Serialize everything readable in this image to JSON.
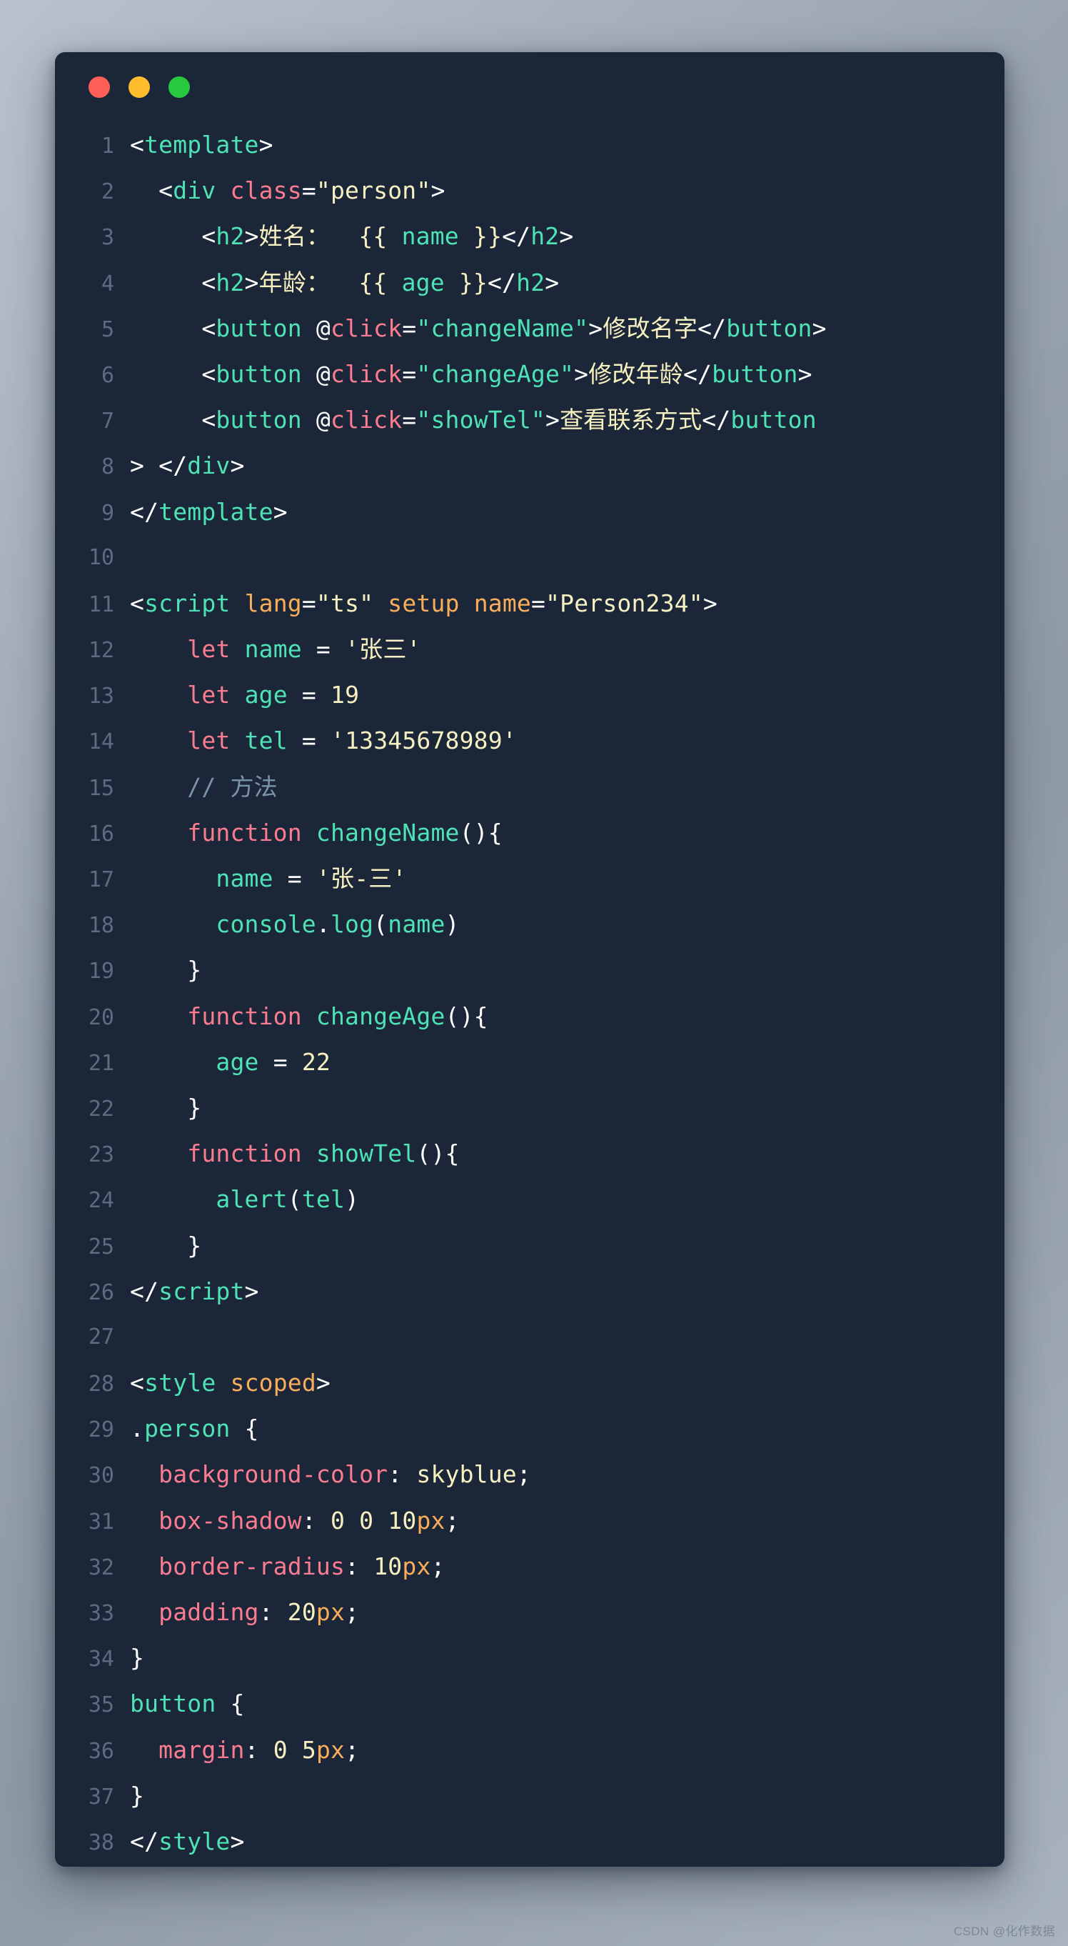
{
  "window": {
    "traffic_lights": [
      {
        "name": "close",
        "color": "#ff5f56"
      },
      {
        "name": "minimize",
        "color": "#ffbd2e"
      },
      {
        "name": "maximize",
        "color": "#27c93f"
      }
    ]
  },
  "editor": {
    "language": "vue",
    "theme_background": "#1b2738",
    "line_count": 38,
    "colors": {
      "punctuation": "#ffffff",
      "tag": "#4ee2b5",
      "attribute": "#fb7b91",
      "attribute_alt": "#f9ad5a",
      "string": "#f7f0c0",
      "keyword": "#fb7b91",
      "function": "#4ee2b5",
      "number": "#f7f0c0",
      "comment": "#7b93a8",
      "property": "#fb7b91",
      "unit": "#f9ad5a",
      "line_number": "#5d6b7f"
    },
    "lines": [
      {
        "n": "1",
        "tokens": [
          {
            "t": "<",
            "c": "punct"
          },
          {
            "t": "template",
            "c": "tag"
          },
          {
            "t": ">",
            "c": "punct"
          }
        ]
      },
      {
        "n": "2",
        "tokens": [
          {
            "t": "  <",
            "c": "punct"
          },
          {
            "t": "div",
            "c": "tag"
          },
          {
            "t": " ",
            "c": "plain"
          },
          {
            "t": "class",
            "c": "attr"
          },
          {
            "t": "=",
            "c": "punct"
          },
          {
            "t": "\"person\"",
            "c": "string"
          },
          {
            "t": ">",
            "c": "punct"
          }
        ]
      },
      {
        "n": "3",
        "tokens": [
          {
            "t": "     <",
            "c": "punct"
          },
          {
            "t": "h2",
            "c": "tag"
          },
          {
            "t": ">",
            "c": "punct"
          },
          {
            "t": "姓名：  {{ ",
            "c": "text"
          },
          {
            "t": "name",
            "c": "var"
          },
          {
            "t": " }}",
            "c": "text"
          },
          {
            "t": "</",
            "c": "punct"
          },
          {
            "t": "h2",
            "c": "tag"
          },
          {
            "t": ">",
            "c": "punct"
          }
        ]
      },
      {
        "n": "4",
        "tokens": [
          {
            "t": "     <",
            "c": "punct"
          },
          {
            "t": "h2",
            "c": "tag"
          },
          {
            "t": ">",
            "c": "punct"
          },
          {
            "t": "年龄：  {{ ",
            "c": "text"
          },
          {
            "t": "age",
            "c": "var"
          },
          {
            "t": " }}",
            "c": "text"
          },
          {
            "t": "</",
            "c": "punct"
          },
          {
            "t": "h2",
            "c": "tag"
          },
          {
            "t": ">",
            "c": "punct"
          }
        ]
      },
      {
        "n": "5",
        "tokens": [
          {
            "t": "     <",
            "c": "punct"
          },
          {
            "t": "button",
            "c": "tag"
          },
          {
            "t": " @",
            "c": "punct"
          },
          {
            "t": "click",
            "c": "attr"
          },
          {
            "t": "=",
            "c": "punct"
          },
          {
            "t": "\"changeName\"",
            "c": "tag"
          },
          {
            "t": ">",
            "c": "punct"
          },
          {
            "t": "修改名字",
            "c": "text"
          },
          {
            "t": "</",
            "c": "punct"
          },
          {
            "t": "button",
            "c": "tag"
          },
          {
            "t": ">",
            "c": "punct"
          }
        ]
      },
      {
        "n": "6",
        "tokens": [
          {
            "t": "     <",
            "c": "punct"
          },
          {
            "t": "button",
            "c": "tag"
          },
          {
            "t": " @",
            "c": "punct"
          },
          {
            "t": "click",
            "c": "attr"
          },
          {
            "t": "=",
            "c": "punct"
          },
          {
            "t": "\"changeAge\"",
            "c": "tag"
          },
          {
            "t": ">",
            "c": "punct"
          },
          {
            "t": "修改年龄",
            "c": "text"
          },
          {
            "t": "</",
            "c": "punct"
          },
          {
            "t": "button",
            "c": "tag"
          },
          {
            "t": ">",
            "c": "punct"
          }
        ]
      },
      {
        "n": "7",
        "tokens": [
          {
            "t": "     <",
            "c": "punct"
          },
          {
            "t": "button",
            "c": "tag"
          },
          {
            "t": " @",
            "c": "punct"
          },
          {
            "t": "click",
            "c": "attr"
          },
          {
            "t": "=",
            "c": "punct"
          },
          {
            "t": "\"showTel\"",
            "c": "tag"
          },
          {
            "t": ">",
            "c": "punct"
          },
          {
            "t": "查看联系方式",
            "c": "text"
          },
          {
            "t": "</",
            "c": "punct"
          },
          {
            "t": "button",
            "c": "tag"
          }
        ]
      },
      {
        "n": "8",
        "tokens": [
          {
            "t": "> </",
            "c": "punct"
          },
          {
            "t": "div",
            "c": "tag"
          },
          {
            "t": ">",
            "c": "punct"
          }
        ]
      },
      {
        "n": "9",
        "tokens": [
          {
            "t": "</",
            "c": "punct"
          },
          {
            "t": "template",
            "c": "tag"
          },
          {
            "t": ">",
            "c": "punct"
          }
        ]
      },
      {
        "n": "10",
        "tokens": []
      },
      {
        "n": "11",
        "tokens": [
          {
            "t": "<",
            "c": "punct"
          },
          {
            "t": "script",
            "c": "tag"
          },
          {
            "t": " ",
            "c": "plain"
          },
          {
            "t": "lang",
            "c": "attr2"
          },
          {
            "t": "=",
            "c": "punct"
          },
          {
            "t": "\"ts\"",
            "c": "string"
          },
          {
            "t": " ",
            "c": "plain"
          },
          {
            "t": "setup",
            "c": "attr2"
          },
          {
            "t": " ",
            "c": "plain"
          },
          {
            "t": "name",
            "c": "attr2"
          },
          {
            "t": "=",
            "c": "punct"
          },
          {
            "t": "\"Person234\"",
            "c": "string"
          },
          {
            "t": ">",
            "c": "punct"
          }
        ]
      },
      {
        "n": "12",
        "tokens": [
          {
            "t": "    ",
            "c": "plain"
          },
          {
            "t": "let",
            "c": "kw"
          },
          {
            "t": " ",
            "c": "plain"
          },
          {
            "t": "name",
            "c": "var"
          },
          {
            "t": " ",
            "c": "plain"
          },
          {
            "t": "=",
            "c": "punct"
          },
          {
            "t": " ",
            "c": "plain"
          },
          {
            "t": "'张三'",
            "c": "string"
          }
        ]
      },
      {
        "n": "13",
        "tokens": [
          {
            "t": "    ",
            "c": "plain"
          },
          {
            "t": "let",
            "c": "kw"
          },
          {
            "t": " ",
            "c": "plain"
          },
          {
            "t": "age",
            "c": "var"
          },
          {
            "t": " ",
            "c": "plain"
          },
          {
            "t": "=",
            "c": "punct"
          },
          {
            "t": " ",
            "c": "plain"
          },
          {
            "t": "19",
            "c": "num"
          }
        ]
      },
      {
        "n": "14",
        "tokens": [
          {
            "t": "    ",
            "c": "plain"
          },
          {
            "t": "let",
            "c": "kw"
          },
          {
            "t": " ",
            "c": "plain"
          },
          {
            "t": "tel",
            "c": "var"
          },
          {
            "t": " ",
            "c": "plain"
          },
          {
            "t": "=",
            "c": "punct"
          },
          {
            "t": " ",
            "c": "plain"
          },
          {
            "t": "'13345678989'",
            "c": "string"
          }
        ]
      },
      {
        "n": "15",
        "tokens": [
          {
            "t": "    ",
            "c": "plain"
          },
          {
            "t": "// 方法",
            "c": "comment"
          }
        ]
      },
      {
        "n": "16",
        "tokens": [
          {
            "t": "    ",
            "c": "plain"
          },
          {
            "t": "function",
            "c": "kw"
          },
          {
            "t": " ",
            "c": "plain"
          },
          {
            "t": "changeName",
            "c": "fn"
          },
          {
            "t": "(){",
            "c": "punct"
          }
        ]
      },
      {
        "n": "17",
        "tokens": [
          {
            "t": "      ",
            "c": "plain"
          },
          {
            "t": "name",
            "c": "var"
          },
          {
            "t": " ",
            "c": "plain"
          },
          {
            "t": "=",
            "c": "punct"
          },
          {
            "t": " ",
            "c": "plain"
          },
          {
            "t": "'张-三'",
            "c": "string"
          }
        ]
      },
      {
        "n": "18",
        "tokens": [
          {
            "t": "      ",
            "c": "plain"
          },
          {
            "t": "console",
            "c": "fn"
          },
          {
            "t": ".",
            "c": "punct"
          },
          {
            "t": "log",
            "c": "fn"
          },
          {
            "t": "(",
            "c": "punct"
          },
          {
            "t": "name",
            "c": "var"
          },
          {
            "t": ")",
            "c": "punct"
          }
        ]
      },
      {
        "n": "19",
        "tokens": [
          {
            "t": "    }",
            "c": "punct"
          }
        ]
      },
      {
        "n": "20",
        "tokens": [
          {
            "t": "    ",
            "c": "plain"
          },
          {
            "t": "function",
            "c": "kw"
          },
          {
            "t": " ",
            "c": "plain"
          },
          {
            "t": "changeAge",
            "c": "fn"
          },
          {
            "t": "(){",
            "c": "punct"
          }
        ]
      },
      {
        "n": "21",
        "tokens": [
          {
            "t": "      ",
            "c": "plain"
          },
          {
            "t": "age",
            "c": "var"
          },
          {
            "t": " ",
            "c": "plain"
          },
          {
            "t": "=",
            "c": "punct"
          },
          {
            "t": " ",
            "c": "plain"
          },
          {
            "t": "22",
            "c": "num"
          }
        ]
      },
      {
        "n": "22",
        "tokens": [
          {
            "t": "    }",
            "c": "punct"
          }
        ]
      },
      {
        "n": "23",
        "tokens": [
          {
            "t": "    ",
            "c": "plain"
          },
          {
            "t": "function",
            "c": "kw"
          },
          {
            "t": " ",
            "c": "plain"
          },
          {
            "t": "showTel",
            "c": "fn"
          },
          {
            "t": "(){",
            "c": "punct"
          }
        ]
      },
      {
        "n": "24",
        "tokens": [
          {
            "t": "      ",
            "c": "plain"
          },
          {
            "t": "alert",
            "c": "fn"
          },
          {
            "t": "(",
            "c": "punct"
          },
          {
            "t": "tel",
            "c": "var"
          },
          {
            "t": ")",
            "c": "punct"
          }
        ]
      },
      {
        "n": "25",
        "tokens": [
          {
            "t": "    }",
            "c": "punct"
          }
        ]
      },
      {
        "n": "26",
        "tokens": [
          {
            "t": "</",
            "c": "punct"
          },
          {
            "t": "script",
            "c": "tag"
          },
          {
            "t": ">",
            "c": "punct"
          }
        ]
      },
      {
        "n": "27",
        "tokens": []
      },
      {
        "n": "28",
        "tokens": [
          {
            "t": "<",
            "c": "punct"
          },
          {
            "t": "style",
            "c": "tag"
          },
          {
            "t": " ",
            "c": "plain"
          },
          {
            "t": "scoped",
            "c": "attr2"
          },
          {
            "t": ">",
            "c": "punct"
          }
        ]
      },
      {
        "n": "29",
        "tokens": [
          {
            "t": ".",
            "c": "punct"
          },
          {
            "t": "person",
            "c": "sel"
          },
          {
            "t": " {",
            "c": "punct"
          }
        ]
      },
      {
        "n": "30",
        "tokens": [
          {
            "t": "  ",
            "c": "plain"
          },
          {
            "t": "background-color",
            "c": "prop"
          },
          {
            "t": ":",
            "c": "punct"
          },
          {
            "t": " ",
            "c": "plain"
          },
          {
            "t": "skyblue",
            "c": "string"
          },
          {
            "t": ";",
            "c": "punct"
          }
        ]
      },
      {
        "n": "31",
        "tokens": [
          {
            "t": "  ",
            "c": "plain"
          },
          {
            "t": "box-shadow",
            "c": "prop"
          },
          {
            "t": ":",
            "c": "punct"
          },
          {
            "t": " ",
            "c": "plain"
          },
          {
            "t": "0",
            "c": "num"
          },
          {
            "t": " ",
            "c": "plain"
          },
          {
            "t": "0",
            "c": "num"
          },
          {
            "t": " ",
            "c": "plain"
          },
          {
            "t": "10",
            "c": "num"
          },
          {
            "t": "px",
            "c": "unit"
          },
          {
            "t": ";",
            "c": "punct"
          }
        ]
      },
      {
        "n": "32",
        "tokens": [
          {
            "t": "  ",
            "c": "plain"
          },
          {
            "t": "border-radius",
            "c": "prop"
          },
          {
            "t": ":",
            "c": "punct"
          },
          {
            "t": " ",
            "c": "plain"
          },
          {
            "t": "10",
            "c": "num"
          },
          {
            "t": "px",
            "c": "unit"
          },
          {
            "t": ";",
            "c": "punct"
          }
        ]
      },
      {
        "n": "33",
        "tokens": [
          {
            "t": "  ",
            "c": "plain"
          },
          {
            "t": "padding",
            "c": "prop"
          },
          {
            "t": ":",
            "c": "punct"
          },
          {
            "t": " ",
            "c": "plain"
          },
          {
            "t": "20",
            "c": "num"
          },
          {
            "t": "px",
            "c": "unit"
          },
          {
            "t": ";",
            "c": "punct"
          }
        ]
      },
      {
        "n": "34",
        "tokens": [
          {
            "t": "}",
            "c": "punct"
          }
        ]
      },
      {
        "n": "35",
        "tokens": [
          {
            "t": "button",
            "c": "sel"
          },
          {
            "t": " {",
            "c": "punct"
          }
        ]
      },
      {
        "n": "36",
        "tokens": [
          {
            "t": "  ",
            "c": "plain"
          },
          {
            "t": "margin",
            "c": "prop"
          },
          {
            "t": ":",
            "c": "punct"
          },
          {
            "t": " ",
            "c": "plain"
          },
          {
            "t": "0",
            "c": "num"
          },
          {
            "t": " ",
            "c": "plain"
          },
          {
            "t": "5",
            "c": "num"
          },
          {
            "t": "px",
            "c": "unit"
          },
          {
            "t": ";",
            "c": "punct"
          }
        ]
      },
      {
        "n": "37",
        "tokens": [
          {
            "t": "}",
            "c": "punct"
          }
        ]
      },
      {
        "n": "38",
        "tokens": [
          {
            "t": "</",
            "c": "punct"
          },
          {
            "t": "style",
            "c": "tag"
          },
          {
            "t": ">",
            "c": "punct"
          }
        ]
      }
    ]
  },
  "watermark": {
    "text": "CSDN @化作数据"
  }
}
